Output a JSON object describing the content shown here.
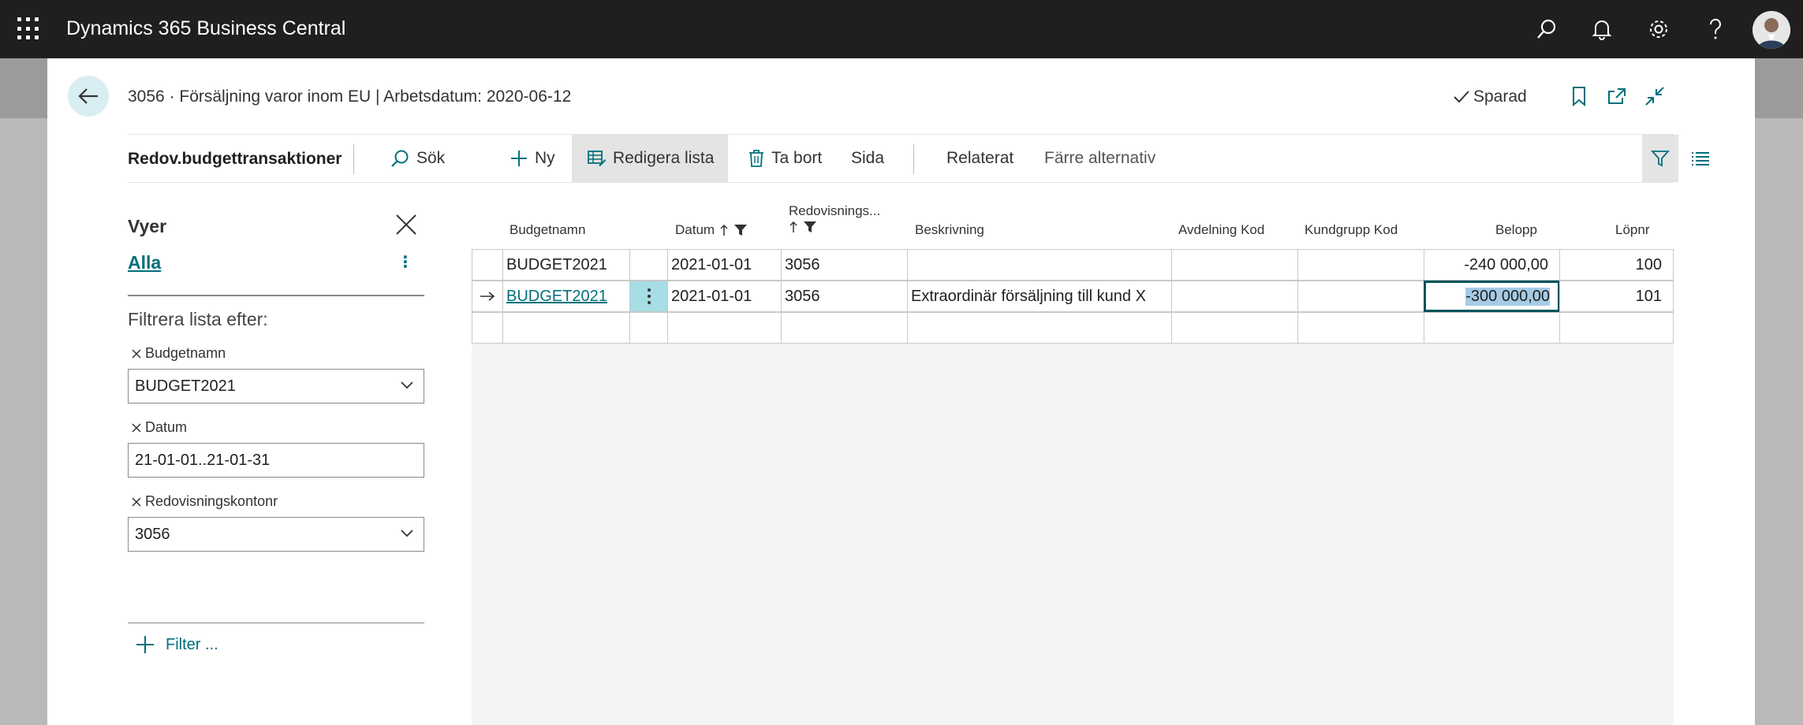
{
  "app": {
    "title": "Dynamics 365 Business Central"
  },
  "page": {
    "title": "3056 · Försäljning varor inom EU | Arbetsdatum: 2020-06-12",
    "saved": "Sparad"
  },
  "actionbar": {
    "title": "Redov.budgettransaktioner",
    "search": "Sök",
    "new": "Ny",
    "edit_list": "Redigera lista",
    "delete": "Ta bort",
    "page": "Sida",
    "related": "Relaterat",
    "fewer_options": "Färre alternativ"
  },
  "filterpane": {
    "title": "Vyer",
    "view": "Alla",
    "heading": "Filtrera lista efter:",
    "filters": [
      {
        "label": "Budgetnamn",
        "value": "BUDGET2021"
      },
      {
        "label": "Datum",
        "value": "21-01-01..21-01-31"
      },
      {
        "label": "Redovisningskontonr",
        "value": "3056"
      }
    ],
    "add_filter": "Filter ..."
  },
  "table": {
    "columns": {
      "budget": "Budgetnamn",
      "date": "Datum",
      "account": "Redovisnings...",
      "description": "Beskrivning",
      "department": "Avdelning Kod",
      "customer_group": "Kundgrupp Kod",
      "amount": "Belopp",
      "entry_no": "Löpnr"
    },
    "rows": [
      {
        "budget": "BUDGET2021",
        "date": "2021-01-01",
        "account": "3056",
        "description": "",
        "department": "",
        "customer_group": "",
        "amount": "-240 000,00",
        "entry_no": "100"
      },
      {
        "budget": "BUDGET2021",
        "date": "2021-01-01",
        "account": "3056",
        "description": "Extraordinär försäljning till kund X",
        "department": "",
        "customer_group": "",
        "amount": "-300 000,00",
        "entry_no": "101"
      }
    ]
  },
  "colors": {
    "topbar": "#1f1f1f",
    "accent": "#00707a",
    "selection": "#a6cbe6"
  }
}
